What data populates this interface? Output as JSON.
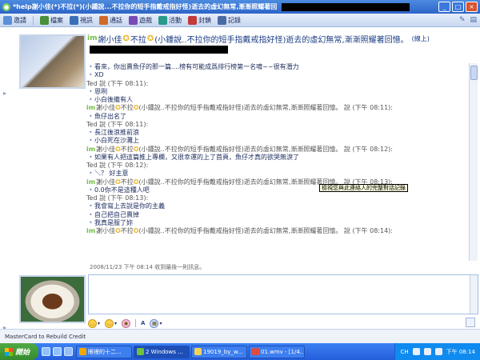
{
  "window": {
    "title": "*help謝小佳(*)不拉(*)(小鍾說...不拉你的短手指戴戒指好怪)逝去的虛幻無常,漸漸照耀著回憶"
  },
  "toolbar": {
    "items": [
      {
        "label": "邀請",
        "icon": "invite-icon",
        "color": "#5b8fd9"
      },
      {
        "label": "檔案",
        "icon": "file-icon",
        "color": "#4a8f3a"
      },
      {
        "label": "視訊",
        "icon": "webcam-icon",
        "color": "#3a6fb5"
      },
      {
        "label": "通話",
        "icon": "phone-icon",
        "color": "#d06a2a"
      },
      {
        "label": "遊戲",
        "icon": "game-icon",
        "color": "#7a4ab5"
      },
      {
        "label": "活動",
        "icon": "activity-icon",
        "color": "#2a9a8a"
      },
      {
        "label": "封鎖",
        "icon": "block-icon",
        "color": "#c23a3a"
      },
      {
        "label": "記錄",
        "icon": "history-icon",
        "color": "#4a6aa6"
      }
    ]
  },
  "conversation": {
    "prefix": "im",
    "name_a": "謝小佳",
    "name_b": "不拉",
    "name_c": "(小鍾說..不拉你的短手指戴戒指好怪)逝去的虛幻無常,漸漸照耀著回憶。",
    "status": "(線上)"
  },
  "chat": {
    "lines": [
      {
        "type": "msg",
        "text": "看來，你出賣魚仔的那一篇....榜有可能成爲排行榜第一名唷~~很有潛力"
      },
      {
        "type": "msg",
        "text": "XD"
      },
      {
        "type": "hdr_plain",
        "text": "Ted 說 (下午 08:11):"
      },
      {
        "type": "msg",
        "text": "恩咧"
      },
      {
        "type": "msg",
        "text": "小白後繼有人"
      },
      {
        "type": "hdr",
        "im": "im",
        "a": "謝小佳",
        "b": "不拉",
        "rest": "(小鍾說..不拉你的短手指戴戒指好怪)逝去的虛幻無常,漸漸照耀著回憶。 說 (下午 08:11):"
      },
      {
        "type": "msg",
        "text": "魚仔出名了"
      },
      {
        "type": "hdr_plain",
        "text": "Ted 說 (下午 08:11):"
      },
      {
        "type": "msg",
        "text": "長江後浪推前浪"
      },
      {
        "type": "msg",
        "text": "小白死在沙灘上"
      },
      {
        "type": "hdr",
        "im": "im",
        "a": "謝小佳",
        "b": "不拉",
        "rest": "(小鍾說..不拉你的短手指戴戒指好怪)逝去的虛幻無常,漸漸照耀著回憶。 說 (下午 08:12):"
      },
      {
        "type": "msg",
        "text": "如果有人把這篇推上專欄，又很幸運的上了首頁，魚仔才真的欲哭無淚了"
      },
      {
        "type": "hdr_plain",
        "text": "Ted 說 (下午 08:12):"
      },
      {
        "type": "msg",
        "text": "＼？ 好主意"
      },
      {
        "type": "hdr",
        "im": "im",
        "a": "謝小佳",
        "b": "不拉",
        "rest": "(小鍾說..不拉你的短手指戴戒指好怪)逝去的虛幻無常,漸漸照耀著回憶。 說 (下午 08:13):"
      },
      {
        "type": "msg",
        "text": "0.0你不是這種人吧"
      },
      {
        "type": "hdr_plain",
        "text": "Ted 說 (下午 08:13):"
      },
      {
        "type": "msg",
        "text": "我會寫上去說是你的主義"
      },
      {
        "type": "msg",
        "text": "自己把自己賣掉"
      },
      {
        "type": "msg",
        "text": "我真是服了妳"
      },
      {
        "type": "hdr",
        "im": "im",
        "a": "謝小佳",
        "b": "不拉",
        "rest": "(小鍾說..不拉你的短手指戴戒指好怪)逝去的虛幻無常,漸漸照耀著回憶。 說 (下午 08:14):"
      }
    ]
  },
  "tooltip": "檢視您與此連絡人的完整對話記錄",
  "last_message": "2008/11/23 下午 08:14 收到最後一則訊息。",
  "emoticon_bar": {
    "font_label": "A"
  },
  "ad": "MasterCard to Rebuild Credit",
  "taskbar": {
    "start_label": "開始",
    "tasks": [
      {
        "label": "眼裡的十二...",
        "icon_color": "#f2a900"
      },
      {
        "label": "2 Windows ...",
        "icon_color": "#6fc13f",
        "active": true
      },
      {
        "label": "19019_by_w...",
        "icon_color": "#f2d35a"
      },
      {
        "label": "01.wmv - [1/4...",
        "icon_color": "#e24a3a"
      }
    ],
    "lang": "CH",
    "clock": "下午 08:14"
  }
}
